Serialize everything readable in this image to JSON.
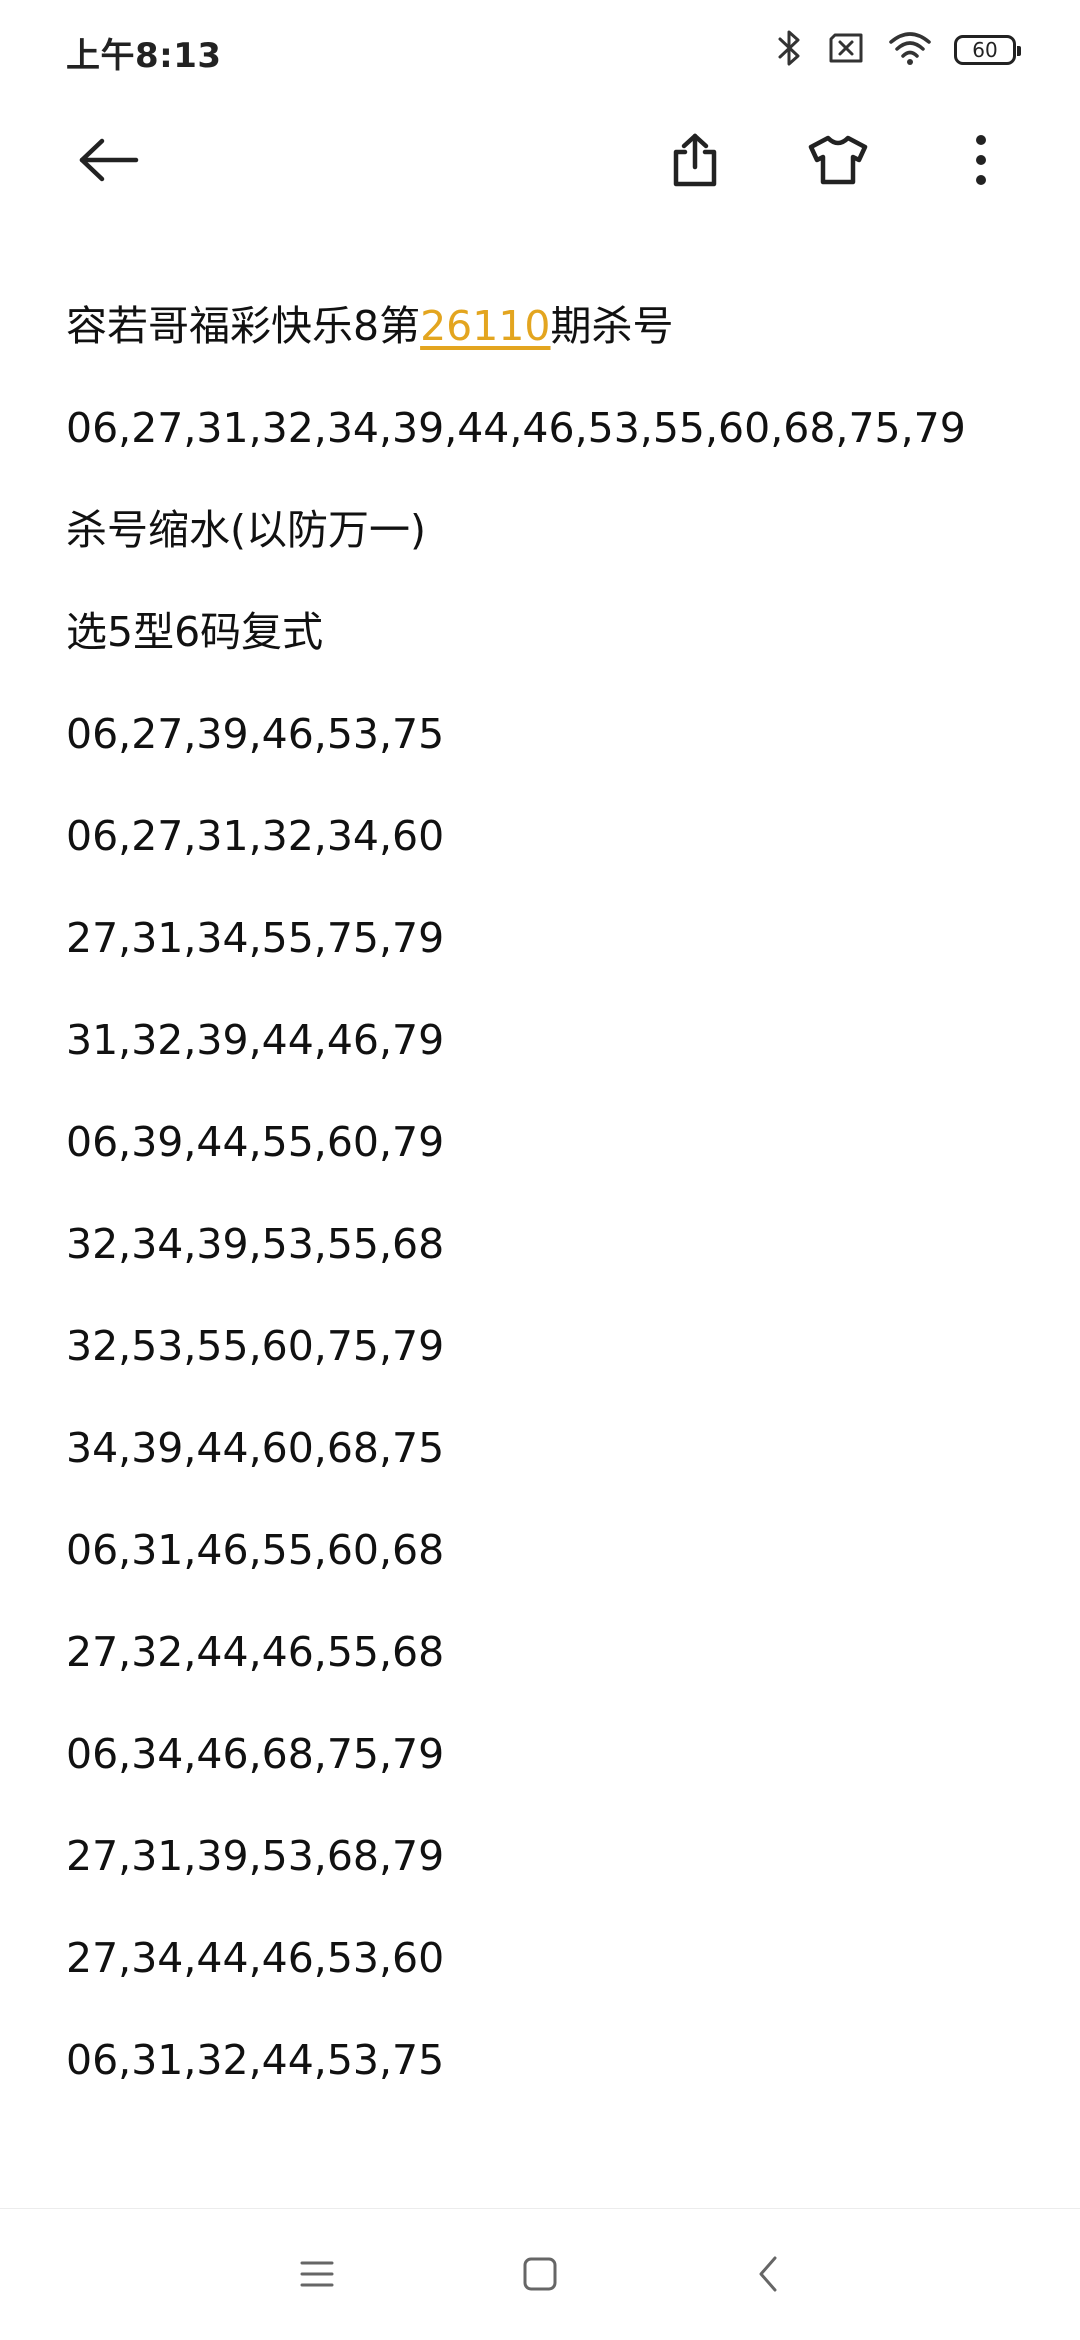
{
  "status_bar": {
    "time": "上午8:13",
    "battery_level": "60",
    "icons": [
      "bluetooth-icon",
      "sim-off-icon",
      "wifi-icon",
      "battery-icon"
    ]
  },
  "toolbar": {
    "buttons": [
      "back-arrow-icon",
      "share-icon",
      "theme-tshirt-icon",
      "more-vertical-icon"
    ]
  },
  "note": {
    "title_prefix": "容若哥福彩快乐8第",
    "issue_number": "26110",
    "title_suffix": "期杀号",
    "kill_numbers": "06,27,31,32,34,39,44,46,53,55,60,68,75,79",
    "subtitle": "杀号缩水(以防万一)",
    "mode": "选5型6码复式",
    "combinations": [
      "06,27,39,46,53,75",
      "06,27,31,32,34,60",
      "27,31,34,55,75,79",
      "31,32,39,44,46,79",
      "06,39,44,55,60,79",
      "32,34,39,53,55,68",
      "32,53,55,60,75,79",
      "34,39,44,60,68,75",
      "06,31,46,55,60,68",
      "27,32,44,46,55,68",
      "06,34,46,68,75,79",
      "27,31,39,53,68,79",
      "27,34,44,46,53,60",
      "06,31,32,44,53,75"
    ]
  },
  "nav_bar": {
    "buttons": [
      "menu-icon",
      "home-icon",
      "back-icon"
    ]
  },
  "colors": {
    "highlight": "#e3a51f",
    "text": "#111111",
    "background": "#ffffff"
  }
}
